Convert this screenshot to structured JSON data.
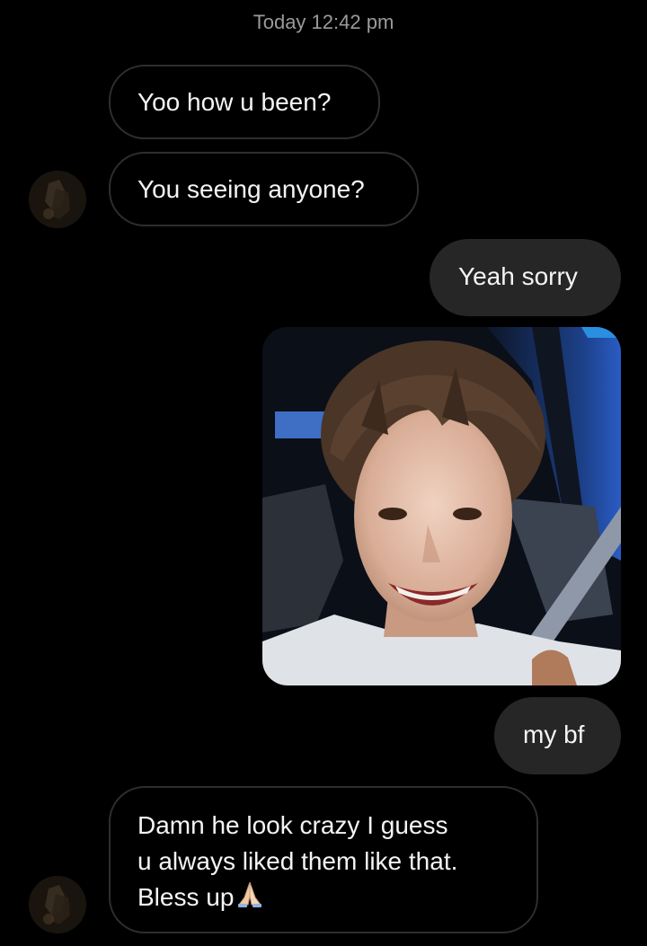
{
  "header": {
    "timestamp": "Today 12:42 pm"
  },
  "messages": [
    {
      "direction": "incoming",
      "text": "Yoo how u been?"
    },
    {
      "direction": "incoming",
      "text": "You seeing anyone?"
    },
    {
      "direction": "outgoing",
      "text": "Yeah sorry"
    },
    {
      "direction": "outgoing",
      "type": "photo",
      "image": "selfie-in-car"
    },
    {
      "direction": "outgoing",
      "text": "my bf"
    },
    {
      "direction": "incoming",
      "lines": [
        "Damn he look crazy I guess",
        "u always liked them like that.",
        "Bless up"
      ],
      "emoji": "folded-hands-icon"
    }
  ],
  "colors": {
    "background": "#000000",
    "incoming_border": "#2e2e2e",
    "outgoing_bubble": "#262626",
    "text": "#f4f4f4",
    "timestamp": "#9a9a9a"
  }
}
